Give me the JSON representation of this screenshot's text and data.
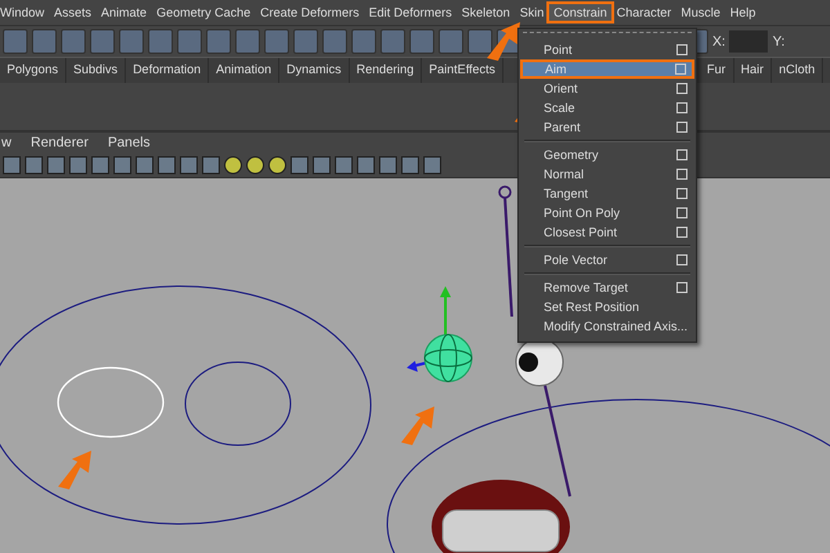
{
  "menubar": [
    {
      "label": "Window",
      "selected": false
    },
    {
      "label": "Assets",
      "selected": false
    },
    {
      "label": "Animate",
      "selected": false
    },
    {
      "label": "Geometry Cache",
      "selected": false
    },
    {
      "label": "Create Deformers",
      "selected": false
    },
    {
      "label": "Edit Deformers",
      "selected": false
    },
    {
      "label": "Skeleton",
      "selected": false
    },
    {
      "label": "Skin",
      "selected": false
    },
    {
      "label": "Constrain",
      "selected": true
    },
    {
      "label": "Character",
      "selected": false
    },
    {
      "label": "Muscle",
      "selected": false
    },
    {
      "label": "Help",
      "selected": false
    }
  ],
  "toolbar": {
    "x_label": "X:",
    "y_label": "Y:"
  },
  "shelf_tabs": [
    {
      "label": "Polygons"
    },
    {
      "label": "Subdivs"
    },
    {
      "label": "Deformation"
    },
    {
      "label": "Animation"
    },
    {
      "label": "Dynamics"
    },
    {
      "label": "Rendering"
    },
    {
      "label": "PaintEffects"
    },
    {
      "label": "Fur"
    },
    {
      "label": "Hair"
    },
    {
      "label": "nCloth"
    }
  ],
  "panel_menu": [
    "w",
    "Renderer",
    "Panels"
  ],
  "constrain_menu": {
    "sections": [
      [
        {
          "label": "Point",
          "selected": false,
          "option_box": true
        },
        {
          "label": "Aim",
          "selected": true,
          "option_box": true
        },
        {
          "label": "Orient",
          "selected": false,
          "option_box": true
        },
        {
          "label": "Scale",
          "selected": false,
          "option_box": true
        },
        {
          "label": "Parent",
          "selected": false,
          "option_box": true
        }
      ],
      [
        {
          "label": "Geometry",
          "selected": false,
          "option_box": true
        },
        {
          "label": "Normal",
          "selected": false,
          "option_box": true
        },
        {
          "label": "Tangent",
          "selected": false,
          "option_box": true
        },
        {
          "label": "Point On Poly",
          "selected": false,
          "option_box": true
        },
        {
          "label": "Closest Point",
          "selected": false,
          "option_box": true
        }
      ],
      [
        {
          "label": "Pole Vector",
          "selected": false,
          "option_box": true
        }
      ],
      [
        {
          "label": "Remove Target",
          "selected": false,
          "option_box": true
        },
        {
          "label": "Set Rest Position",
          "selected": false,
          "option_box": false
        },
        {
          "label": "Modify Constrained Axis...",
          "selected": false,
          "option_box": false
        }
      ]
    ]
  }
}
